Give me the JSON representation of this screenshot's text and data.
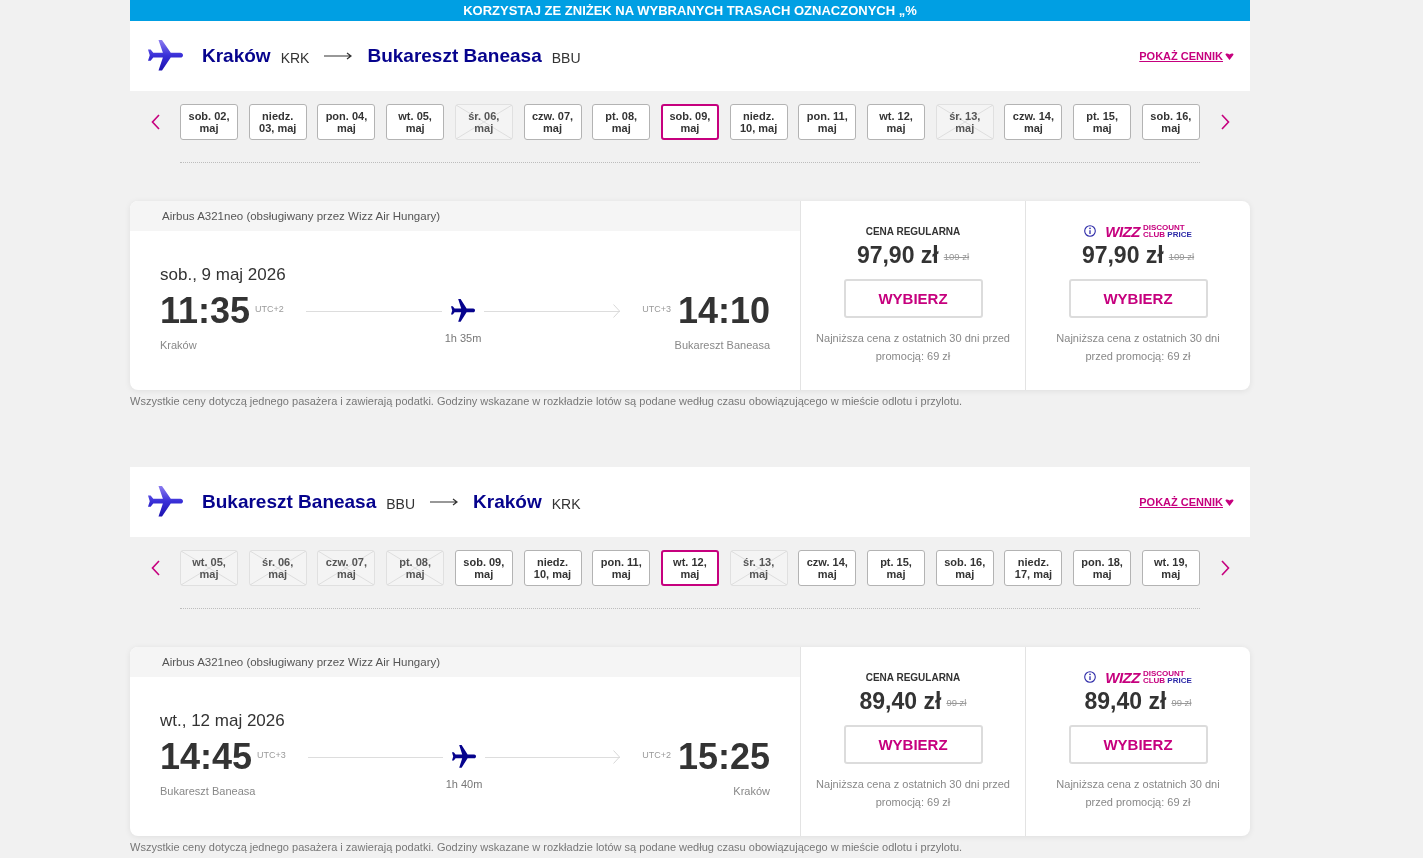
{
  "banner": {
    "text": "KORZYSTAJ ZE ZNIŻEK NA WYBRANYCH TRASACH OZNACZONYCH „%"
  },
  "journeys": [
    {
      "origin": {
        "city": "Kraków",
        "code": "KRK"
      },
      "destination": {
        "city": "Bukareszt Baneasa",
        "code": "BBU"
      },
      "price_list_link": "POKAŻ CENNIK",
      "dates": [
        {
          "label": "sob. 02, maj",
          "selected": false,
          "available": true
        },
        {
          "label": "niedz. 03, maj",
          "selected": false,
          "available": true
        },
        {
          "label": "pon. 04, maj",
          "selected": false,
          "available": true
        },
        {
          "label": "wt. 05, maj",
          "selected": false,
          "available": true
        },
        {
          "label": "śr. 06, maj",
          "selected": false,
          "available": false
        },
        {
          "label": "czw. 07, maj",
          "selected": false,
          "available": true
        },
        {
          "label": "pt. 08, maj",
          "selected": false,
          "available": true
        },
        {
          "label": "sob. 09, maj",
          "selected": true,
          "available": true
        },
        {
          "label": "niedz. 10, maj",
          "selected": false,
          "available": true
        },
        {
          "label": "pon. 11, maj",
          "selected": false,
          "available": true
        },
        {
          "label": "wt. 12, maj",
          "selected": false,
          "available": true
        },
        {
          "label": "śr. 13, maj",
          "selected": false,
          "available": false
        },
        {
          "label": "czw. 14, maj",
          "selected": false,
          "available": true
        },
        {
          "label": "pt. 15, maj",
          "selected": false,
          "available": true
        },
        {
          "label": "sob. 16, maj",
          "selected": false,
          "available": true
        }
      ],
      "flight": {
        "aircraft": "Airbus A321neo (obsługiwany przez Wizz Air Hungary)",
        "date": "sob., 9 maj 2026",
        "departure": {
          "time": "11:35",
          "utc": "UTC+2",
          "city": "Kraków"
        },
        "arrival": {
          "time": "14:10",
          "utc": "UTC+3",
          "city": "Bukareszt Baneasa"
        },
        "duration": "1h 35m",
        "fares": [
          {
            "kind": "regular",
            "label": "CENA REGULARNA",
            "price": "97,90 zł",
            "old_price": "109 zł",
            "button": "WYBIERZ",
            "note": "Najniższa cena z ostatnich 30 dni przed promocją: 69 zł"
          },
          {
            "kind": "club",
            "logo": {
              "wordmark": "WIZZ",
              "line_1": "DISCOUNT",
              "line_2": "CLUB",
              "line_2_accent": "PRICE"
            },
            "price": "97,90 zł",
            "old_price": "109 zł",
            "button": "WYBIERZ",
            "note": "Najniższa cena z ostatnich 30 dni przed promocją: 69 zł"
          }
        ]
      },
      "disclaimer": "Wszystkie ceny dotyczą jednego pasażera i zawierają podatki. Godziny wskazane w rozkładzie lotów są podane według czasu obowiązującego w mieście odlotu i przylotu."
    },
    {
      "origin": {
        "city": "Bukareszt Baneasa",
        "code": "BBU"
      },
      "destination": {
        "city": "Kraków",
        "code": "KRK"
      },
      "price_list_link": "POKAŻ CENNIK",
      "dates": [
        {
          "label": "wt. 05, maj",
          "selected": false,
          "available": false
        },
        {
          "label": "śr. 06, maj",
          "selected": false,
          "available": false
        },
        {
          "label": "czw. 07, maj",
          "selected": false,
          "available": false
        },
        {
          "label": "pt. 08, maj",
          "selected": false,
          "available": false
        },
        {
          "label": "sob. 09, maj",
          "selected": false,
          "available": true
        },
        {
          "label": "niedz. 10, maj",
          "selected": false,
          "available": true
        },
        {
          "label": "pon. 11, maj",
          "selected": false,
          "available": true
        },
        {
          "label": "wt. 12, maj",
          "selected": true,
          "available": true
        },
        {
          "label": "śr. 13, maj",
          "selected": false,
          "available": false
        },
        {
          "label": "czw. 14, maj",
          "selected": false,
          "available": true
        },
        {
          "label": "pt. 15, maj",
          "selected": false,
          "available": true
        },
        {
          "label": "sob. 16, maj",
          "selected": false,
          "available": true
        },
        {
          "label": "niedz. 17, maj",
          "selected": false,
          "available": true
        },
        {
          "label": "pon. 18, maj",
          "selected": false,
          "available": true
        },
        {
          "label": "wt. 19, maj",
          "selected": false,
          "available": true
        }
      ],
      "flight": {
        "aircraft": "Airbus A321neo (obsługiwany przez Wizz Air Hungary)",
        "date": "wt., 12 maj 2026",
        "departure": {
          "time": "14:45",
          "utc": "UTC+3",
          "city": "Bukareszt Baneasa"
        },
        "arrival": {
          "time": "15:25",
          "utc": "UTC+2",
          "city": "Kraków"
        },
        "duration": "1h 40m",
        "fares": [
          {
            "kind": "regular",
            "label": "CENA REGULARNA",
            "price": "89,40 zł",
            "old_price": "99 zł",
            "button": "WYBIERZ",
            "note": "Najniższa cena z ostatnich 30 dni przed promocją: 69 zł"
          },
          {
            "kind": "club",
            "logo": {
              "wordmark": "WIZZ",
              "line_1": "DISCOUNT",
              "line_2": "CLUB",
              "line_2_accent": "PRICE"
            },
            "price": "89,40 zł",
            "old_price": "99 zł",
            "button": "WYBIERZ",
            "note": "Najniższa cena z ostatnich 30 dni przed promocją: 69 zł"
          }
        ]
      },
      "disclaimer": "Wszystkie ceny dotyczą jednego pasażera i zawierają podatki. Godziny wskazane w rozkładzie lotów są podane według czasu obowiązującego w mieście odlotu i przylotu."
    }
  ]
}
